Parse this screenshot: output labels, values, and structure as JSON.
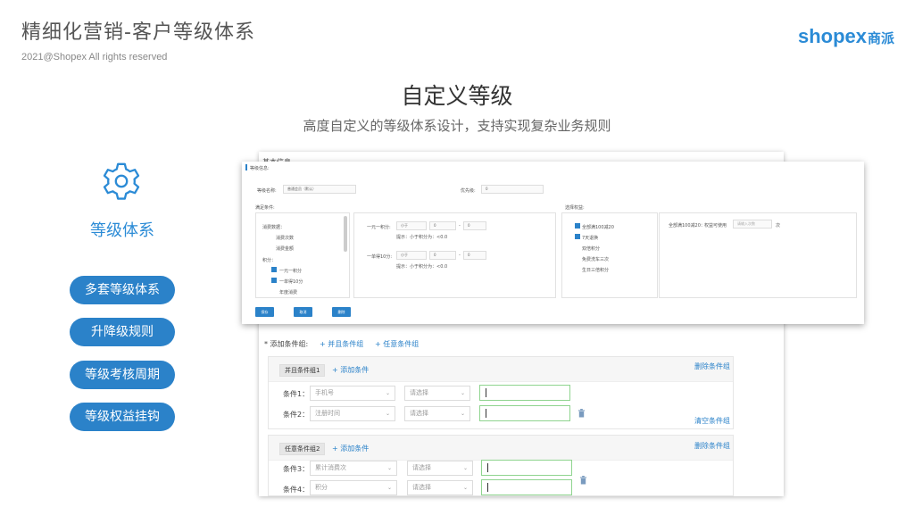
{
  "slide": {
    "title": "精细化营销-客户等级体系",
    "copyright": "2021@Shopex All rights reserved",
    "logo_text": "shopex",
    "logo_cn": "商派",
    "heading": "自定义等级",
    "subheading": "高度自定义的等级体系设计，支持实现复杂业务规则"
  },
  "sidebar": {
    "icon": "gear-icon",
    "title": "等级体系",
    "pills": [
      "多套等级体系",
      "升降级规则",
      "等级考核周期",
      "等级权益挂钩"
    ]
  },
  "colors": {
    "accent": "#2b82c9",
    "valid_border": "#8fd48f"
  },
  "back_panel": {
    "partial_tab": "基本信息",
    "add_group_label": "* 添加条件组:",
    "add_and_group": "+ 并且条件组",
    "add_or_group": "+ 任意条件组",
    "groups": [
      {
        "tag": "并且条件组1",
        "add_condition": "+ 添加条件",
        "delete_group": "删除条件组",
        "clear_group": "清空条件组",
        "conditions": [
          {
            "label": "条件1：",
            "field": "手机号",
            "operator": "请选择",
            "value": ""
          },
          {
            "label": "条件2：",
            "field": "注册时间",
            "operator": "请选择",
            "value": ""
          }
        ]
      },
      {
        "tag": "任意条件组2",
        "add_condition": "+ 添加条件",
        "delete_group": "删除条件组",
        "conditions": [
          {
            "label": "条件3：",
            "field": "累计消费次",
            "operator": "请选择",
            "value": ""
          },
          {
            "label": "条件4：",
            "field": "积分",
            "operator": "请选择",
            "value": ""
          }
        ]
      }
    ]
  },
  "front_panel": {
    "section": "等级信息:",
    "name_label": "等级名称:",
    "name_value": "普通会员（默认）",
    "priority_label": "优先级:",
    "priority_value": "0",
    "meet_label": "满足条件:",
    "rights_label": "选择权益:",
    "tree": {
      "g1": "消费数据：",
      "i1": "消费次数",
      "i2": "消费金额",
      "g2": "积分：",
      "i3": "一元一积分",
      "i4": "一单得10分",
      "i5": "年度消费"
    },
    "rule1": {
      "label": "一元一积分:",
      "op": "小于",
      "val": "0",
      "sep": "-",
      "val2": "0",
      "hint": "提示：小于积分为：<0.0"
    },
    "rule2": {
      "label": "一单得10分:",
      "op": "小于",
      "val": "0",
      "sep": "-",
      "val2": "0",
      "hint": "提示：小于积分为：<0.0"
    },
    "rights": [
      "全部满100减20",
      "7天退换",
      "双倍积分",
      "免费洗车三次",
      "生日三倍积分"
    ],
    "rights_detail": {
      "label": "全部满100减20：",
      "usage": "权益可使用",
      "placeholder": "请输入次数",
      "unit": "次"
    },
    "buttons": [
      "保存",
      "取消",
      "删除"
    ]
  }
}
